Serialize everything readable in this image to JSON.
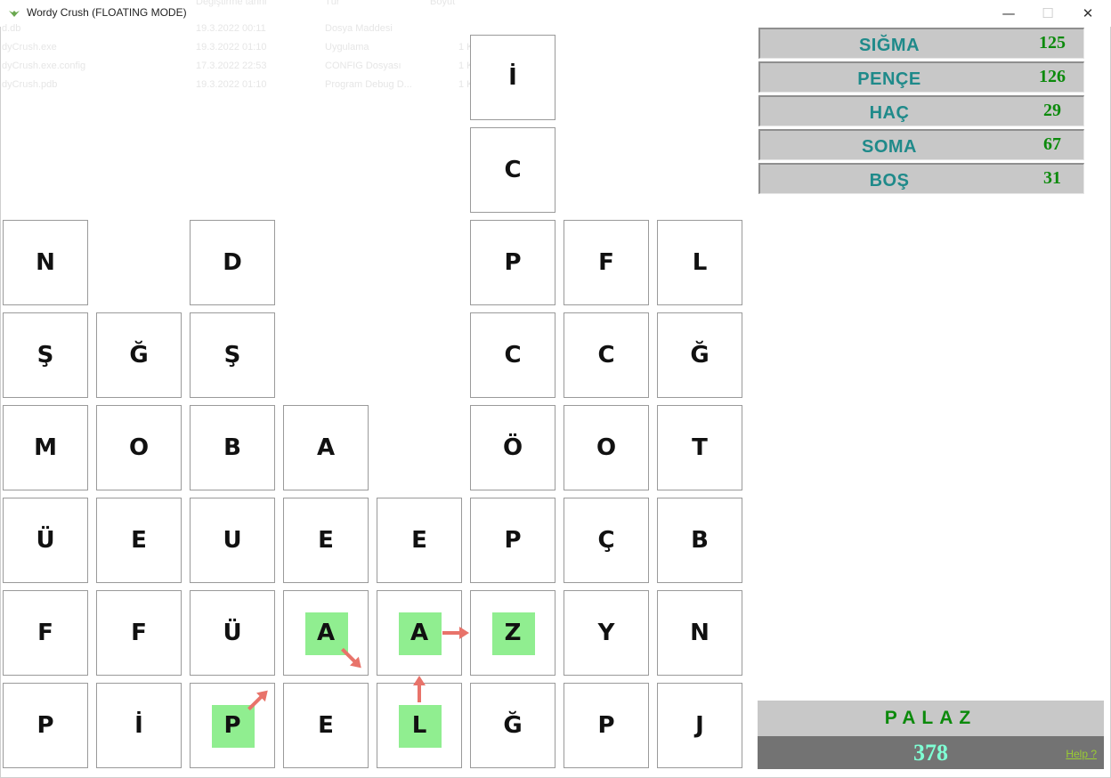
{
  "window": {
    "title": "Wordy Crush (FLOATING MODE)",
    "minimize_glyph": "—",
    "maximize_glyph": "☐",
    "close_glyph": "✕"
  },
  "background_explorer": {
    "headers": [
      "Değiştirme tarihi",
      "Tür",
      "Boyut"
    ],
    "rows": [
      {
        "name": "d.db",
        "date": "19.3.2022 00:11",
        "type": "Dosya Maddesi",
        "size": ""
      },
      {
        "name": "dyCrush.exe",
        "date": "19.3.2022 01:10",
        "type": "Uygulama",
        "size": "1 KB"
      },
      {
        "name": "dyCrush.exe.config",
        "date": "17.3.2022 22:53",
        "type": "CONFIG Dosyası",
        "size": "1 KB"
      },
      {
        "name": "dyCrush.pdb",
        "date": "19.3.2022 01:10",
        "type": "Program Debug D...",
        "size": "1 KB"
      }
    ]
  },
  "grid": {
    "columns": [
      [
        "N",
        "Ş",
        "M",
        "Ü",
        "F",
        "P"
      ],
      [
        "Ğ",
        "O",
        "E",
        "F",
        "İ"
      ],
      [
        "D",
        "Ş",
        "B",
        "U",
        "Ü",
        "P"
      ],
      [
        "A",
        "E",
        "A",
        "E"
      ],
      [
        "E",
        "A",
        "L"
      ],
      [
        "İ",
        "C",
        "P",
        "C",
        "Ö",
        "P",
        "Z",
        "Ğ"
      ],
      [
        "F",
        "C",
        "O",
        "Ç",
        "Y",
        "P"
      ],
      [
        "L",
        "Ğ",
        "T",
        "B",
        "N",
        "J"
      ]
    ],
    "selected_path": [
      {
        "col": 2,
        "letter": "P"
      },
      {
        "col": 3,
        "letter": "A"
      },
      {
        "col": 4,
        "letter": "L"
      },
      {
        "col": 4,
        "letter": "A"
      },
      {
        "col": 5,
        "letter": "Z"
      }
    ],
    "highlight_color": "#90ee90",
    "arrow_color": "#e8736a"
  },
  "found_words": [
    {
      "word": "SIĞMA",
      "score": "125"
    },
    {
      "word": "PENÇE",
      "score": "126"
    },
    {
      "word": "HAÇ",
      "score": "29"
    },
    {
      "word": "SOMA",
      "score": "67"
    },
    {
      "word": "BOŞ",
      "score": "31"
    }
  ],
  "current_word": "PALAZ",
  "total_score": "378",
  "help_label": "Help ?"
}
